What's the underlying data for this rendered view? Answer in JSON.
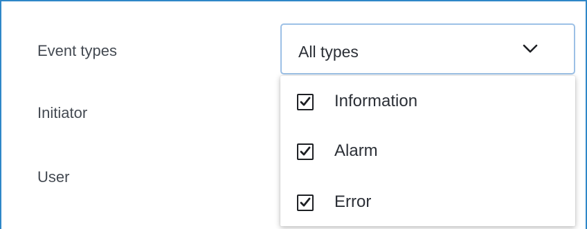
{
  "colors": {
    "panel_border": "#2f87c8",
    "select_focus_border": "#9cc0e6",
    "label_text": "#444a52",
    "value_text": "#2b2f36"
  },
  "form": {
    "rows": [
      {
        "label": "Event types"
      },
      {
        "label": "Initiator"
      },
      {
        "label": "User"
      }
    ],
    "event_types_select": {
      "value": "All types",
      "icon": "chevron-down-icon",
      "expanded": true,
      "options": [
        {
          "label": "Information",
          "checked": true
        },
        {
          "label": "Alarm",
          "checked": true
        },
        {
          "label": "Error",
          "checked": true
        }
      ]
    }
  }
}
